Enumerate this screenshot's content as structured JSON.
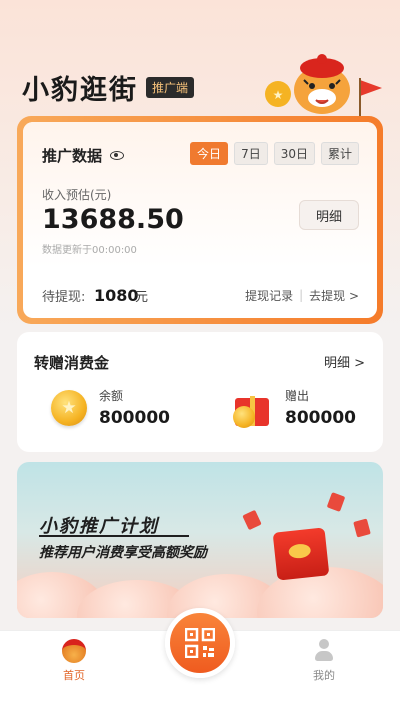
{
  "header": {
    "title": "小豹逛街",
    "tag": "推广端"
  },
  "promo": {
    "title": "推广数据",
    "tabs": [
      "今日",
      "7日",
      "30日",
      "累计"
    ],
    "income_label": "收入预估(元)",
    "income_value": "13688.50",
    "update_time": "数据更新于00:00:00",
    "detail_button": "明细",
    "withdraw_label": "待提现:",
    "withdraw_amount": "1080",
    "withdraw_unit": "元",
    "withdraw_record": "提现记录",
    "go_withdraw": "去提现 >"
  },
  "transfer": {
    "title": "转赠消费金",
    "detail_link": "明细 >",
    "balance_label": "余额",
    "balance_value": "800000",
    "gift_label": "赠出",
    "gift_value": "800000"
  },
  "banner": {
    "title": "小豹推广计划",
    "subtitle": "推荐用户消费享受高额奖励"
  },
  "nav": {
    "home": "首页",
    "me": "我的"
  },
  "colors": {
    "accent": "#f07a2f",
    "card_border": "#f57b2a"
  }
}
